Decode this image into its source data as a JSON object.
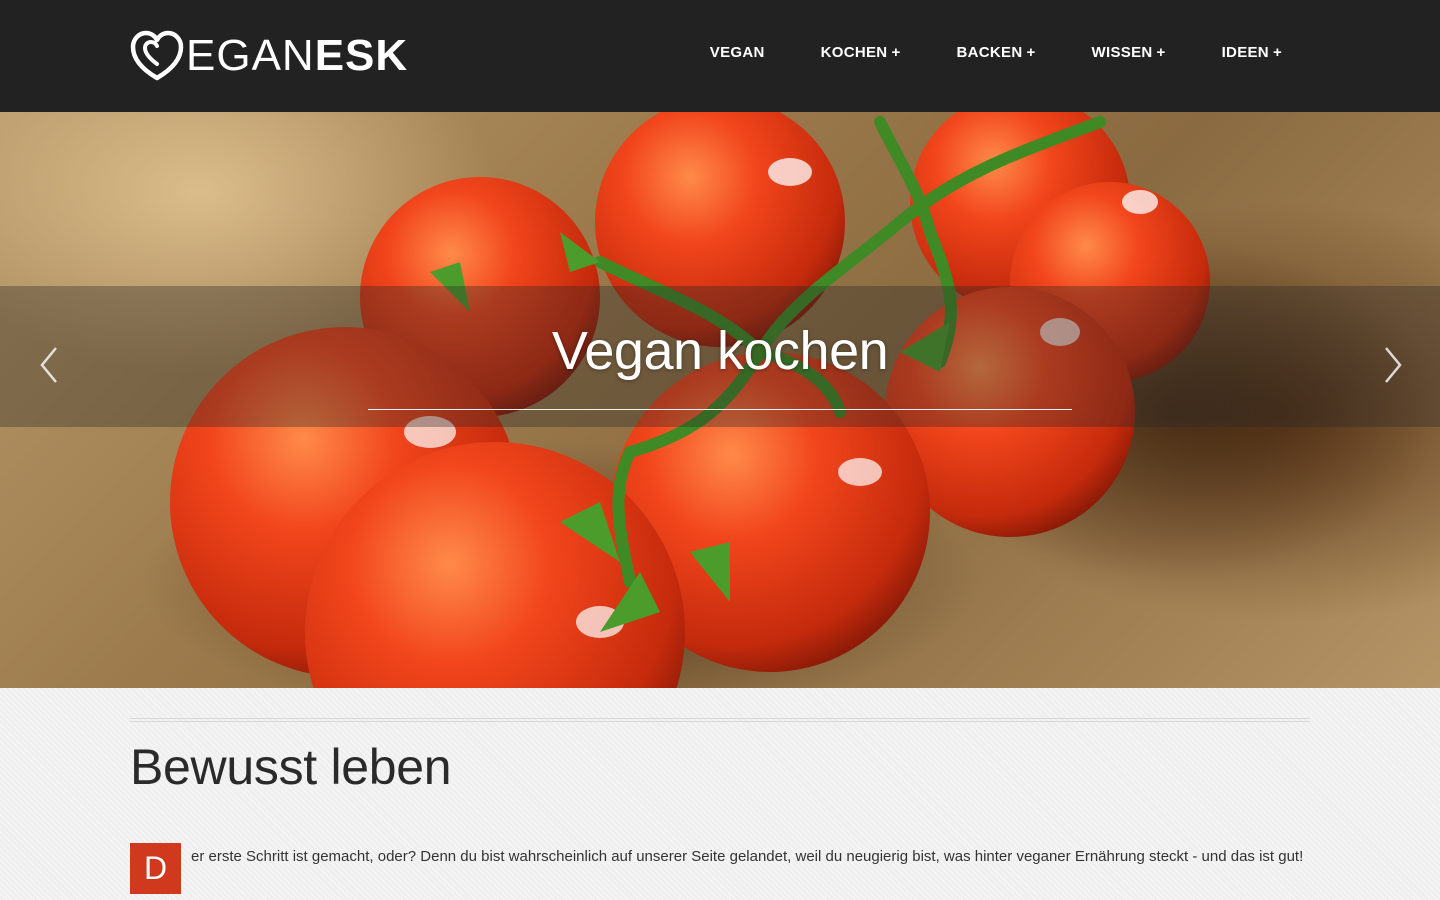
{
  "header": {
    "logo": {
      "icon": "heart-icon",
      "text_light": "EGAN",
      "text_bold": "ESK"
    },
    "nav": [
      {
        "label": "VEGAN",
        "has_submenu": false
      },
      {
        "label": "KOCHEN",
        "has_submenu": true
      },
      {
        "label": "BACKEN",
        "has_submenu": true
      },
      {
        "label": "WISSEN",
        "has_submenu": true
      },
      {
        "label": "IDEEN",
        "has_submenu": true
      }
    ],
    "submenu_symbol": "+"
  },
  "hero": {
    "title": "Vegan kochen",
    "prev_icon": "chevron-left-icon",
    "next_icon": "chevron-right-icon"
  },
  "main": {
    "heading": "Bewusst leben",
    "dropcap": "D",
    "intro": "er erste Schritt ist gemacht, oder? Denn du bist wahrscheinlich auf unserer Seite gelandet, weil du neugierig bist, was hinter veganer Ernährung steckt - und das ist gut!"
  },
  "colors": {
    "header_bg": "#222222",
    "accent": "#d0391e",
    "page_bg": "#efefef"
  }
}
